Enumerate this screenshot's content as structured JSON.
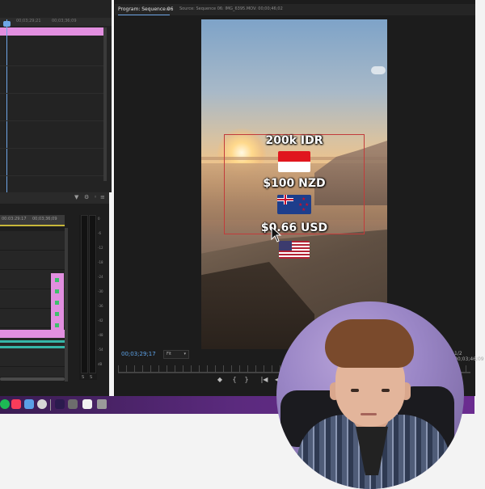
{
  "source_panel": {
    "ruler_left": "00;03;29;21",
    "ruler_right": "00;03;36;09"
  },
  "timeline": {
    "ruler_left": "00:03:29:17",
    "ruler_right": "00;03;36;09",
    "meter_scale": [
      "0",
      "-6",
      "-12",
      "-18",
      "-24",
      "-30",
      "-36",
      "-42",
      "-48",
      "-54",
      "dB"
    ],
    "meter_solo": [
      "S",
      "S"
    ]
  },
  "monitor": {
    "program_tab": "Program: Sequence 06",
    "program_tab_menu": "≡",
    "source_tab": "Source: Sequence 06: IMG_6395.MOV: 00;00;46;02",
    "timecode": "00;03;29;17",
    "fit_label": "Fit",
    "end_timecode": "1/2  00;03;46;09",
    "controls": [
      "◆",
      "{",
      "}",
      "|◀",
      "◀",
      "▶"
    ]
  },
  "video": {
    "price_1": "200k IDR",
    "price_2": "$100 NZD",
    "price_3": "$0.66 USD",
    "flags": [
      "indonesia-flag",
      "new-zealand-flag",
      "usa-flag"
    ]
  },
  "colors": {
    "accent_blue": "#5da3e8",
    "clip_pink": "#e28fe0",
    "dock_purple": "#5b2a7e",
    "selection_red": "#c23b3b"
  },
  "dock": {
    "apps": [
      "spotify-icon",
      "music-icon",
      "finder-icon",
      "chrome-icon",
      "premiere-icon",
      "preview-icon",
      "notes-icon",
      "trash-icon"
    ]
  }
}
